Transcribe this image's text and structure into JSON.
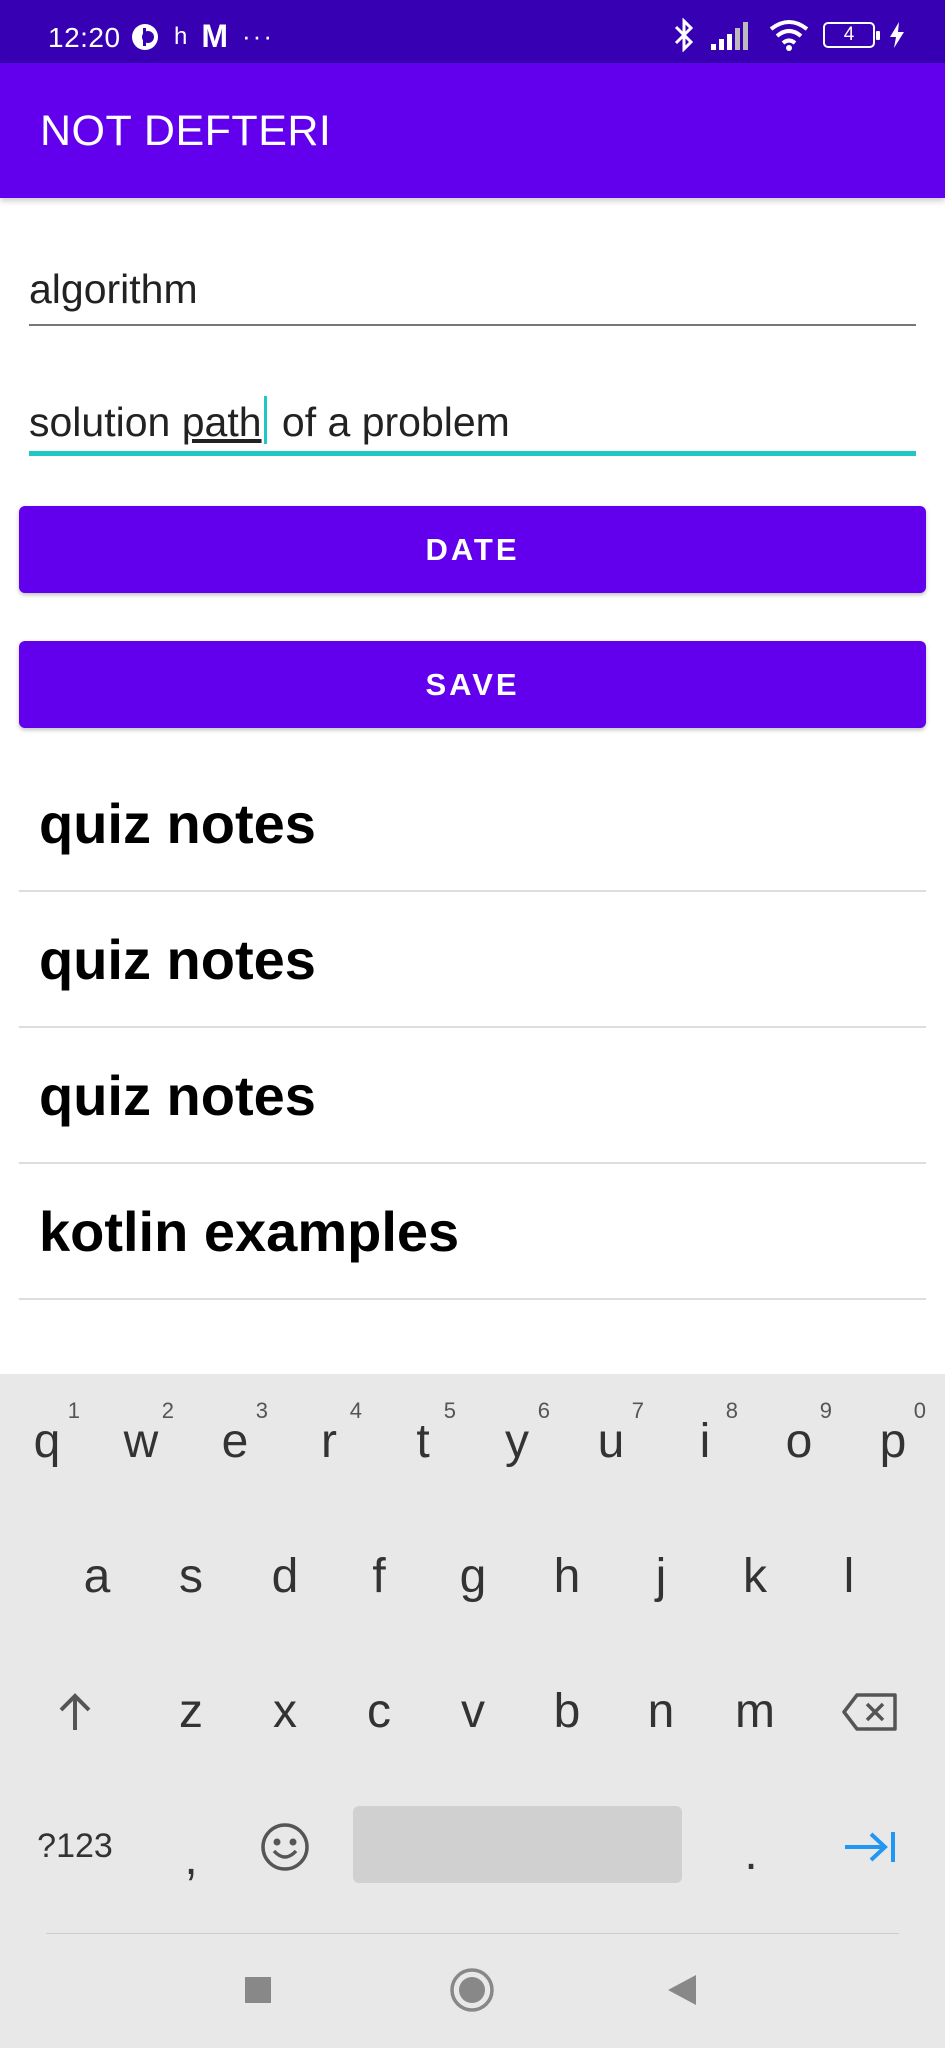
{
  "status_bar": {
    "time": "12:20",
    "h_label": "h",
    "m_label": "M",
    "dots": "···",
    "battery": "4"
  },
  "appbar": {
    "title": "NOT DEFTERI"
  },
  "inputs": {
    "title_value": "algorithm",
    "desc_part1": "solution ",
    "desc_underlined": "path",
    "desc_part2": " of a problem"
  },
  "buttons": {
    "date_label": "DATE",
    "save_label": "SAVE"
  },
  "notes": [
    "quiz notes",
    "quiz notes",
    "quiz notes",
    "kotlin examples"
  ],
  "keyboard": {
    "row1": [
      {
        "key": "q",
        "hint": "1"
      },
      {
        "key": "w",
        "hint": "2"
      },
      {
        "key": "e",
        "hint": "3"
      },
      {
        "key": "r",
        "hint": "4"
      },
      {
        "key": "t",
        "hint": "5"
      },
      {
        "key": "y",
        "hint": "6"
      },
      {
        "key": "u",
        "hint": "7"
      },
      {
        "key": "i",
        "hint": "8"
      },
      {
        "key": "o",
        "hint": "9"
      },
      {
        "key": "p",
        "hint": "0"
      }
    ],
    "row2": [
      "a",
      "s",
      "d",
      "f",
      "g",
      "h",
      "j",
      "k",
      "l"
    ],
    "row3": [
      "z",
      "x",
      "c",
      "v",
      "b",
      "n",
      "m"
    ],
    "symbols_label": "?123",
    "comma": ",",
    "period": "."
  },
  "colors": {
    "status_bar": "#3700b3",
    "primary": "#6200ee",
    "accent": "#21c7c7",
    "keyboard_bg": "#e8e8e8",
    "enter_key": "#2196f3"
  }
}
